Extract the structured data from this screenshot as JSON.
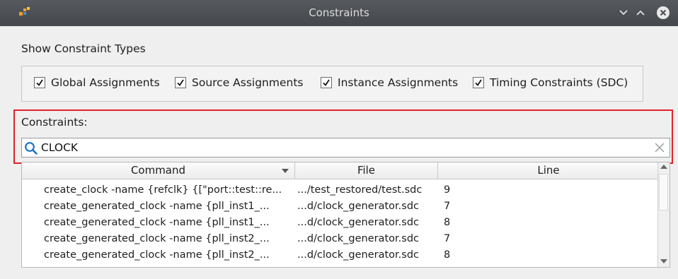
{
  "window": {
    "title": "Constraints"
  },
  "show_types": {
    "label": "Show Constraint Types",
    "options": [
      {
        "label": "Global Assignments",
        "checked": true
      },
      {
        "label": "Source Assignments",
        "checked": true
      },
      {
        "label": "Instance Assignments",
        "checked": true
      },
      {
        "label": "Timing Constraints (SDC)",
        "checked": true
      }
    ]
  },
  "constraints": {
    "label": "Constraints:",
    "search_value": "CLOCK"
  },
  "table": {
    "columns": [
      "Command",
      "File",
      "Line"
    ],
    "rows": [
      {
        "command": "create_clock -name {refclk} {[\"port::test::re...",
        "file": ".../test_restored/test.sdc",
        "line": "9"
      },
      {
        "command": "create_generated_clock -name {pll_inst1_...",
        "file": "...d/clock_generator.sdc",
        "line": "7"
      },
      {
        "command": "create_generated_clock -name {pll_inst1_...",
        "file": "...d/clock_generator.sdc",
        "line": "8"
      },
      {
        "command": "create_generated_clock -name {pll_inst2_...",
        "file": "...d/clock_generator.sdc",
        "line": "7"
      },
      {
        "command": "create_generated_clock -name {pll_inst2_...",
        "file": "...d/clock_generator.sdc",
        "line": "8"
      }
    ]
  },
  "colors": {
    "highlight_frame": "#e0222a",
    "titlebar": "#4b4e52",
    "search_icon": "#1a73c8"
  }
}
